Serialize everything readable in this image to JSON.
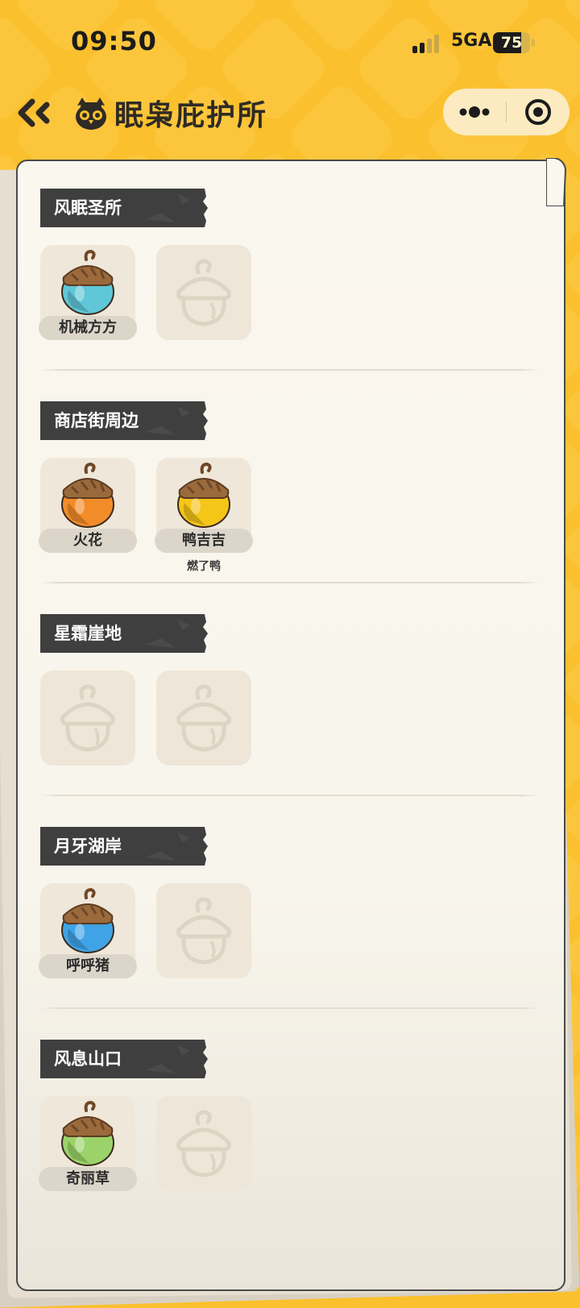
{
  "status_bar": {
    "time": "09:50",
    "network": "5GA",
    "battery": "75",
    "battery_level": 0.75
  },
  "header": {
    "title": "眠枭庇护所",
    "back_icon": "double-chevron-left-icon",
    "title_icon": "owl-icon",
    "more_icon": "more-dots-icon",
    "close_icon": "target-icon"
  },
  "colors": {
    "background": "#FBC02D",
    "paper": "#FAF7EE",
    "section_tag": "#3f3f3f",
    "slot": "#EFE7D9"
  },
  "sections": [
    {
      "title": "风眠圣所",
      "slots": [
        {
          "name": "机械方方",
          "sub": "",
          "color": "#5FC7D8"
        },
        {
          "empty": true
        }
      ]
    },
    {
      "title": "商店街周边",
      "slots": [
        {
          "name": "火花",
          "sub": "",
          "color": "#F28C28"
        },
        {
          "name": "鸭吉吉",
          "sub": "燃了鸭",
          "color": "#F5C518"
        }
      ]
    },
    {
      "title": "星霜崖地",
      "slots": [
        {
          "empty": true
        },
        {
          "empty": true
        }
      ]
    },
    {
      "title": "月牙湖岸",
      "slots": [
        {
          "name": "呼呼猪",
          "sub": "",
          "color": "#3FA3E6"
        },
        {
          "empty": true
        }
      ]
    },
    {
      "title": "风息山口",
      "slots": [
        {
          "name": "奇丽草",
          "sub": "",
          "color": "#9BD36A"
        },
        {
          "empty": true
        }
      ]
    }
  ]
}
